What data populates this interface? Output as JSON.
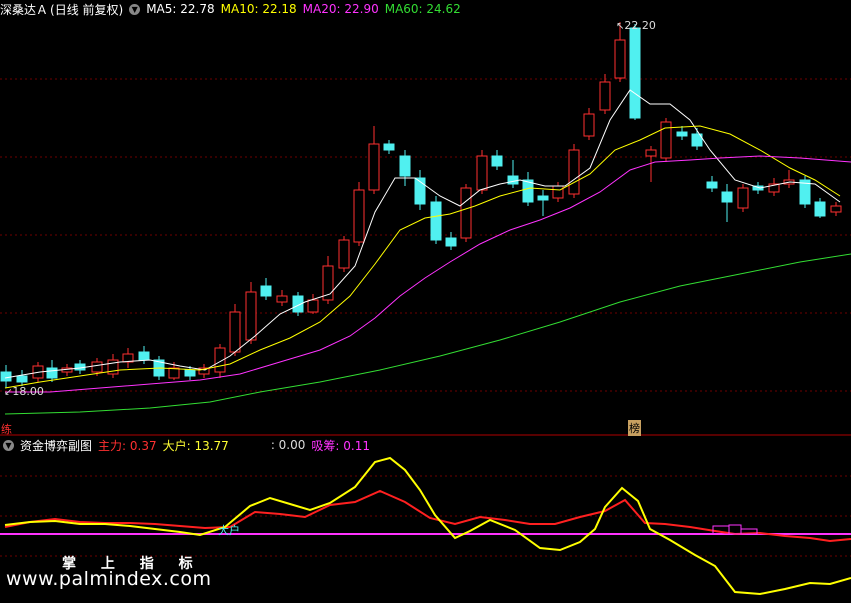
{
  "main_header": {
    "stock": "深桑达Ａ",
    "adjust": "(日线 前复权)",
    "ma": [
      {
        "label": "MA5: 22.78",
        "color": "#ffffff"
      },
      {
        "label": "MA10: 22.18",
        "color": "#ffff00"
      },
      {
        "label": "MA20: 22.90",
        "color": "#ff33ff"
      },
      {
        "label": "MA60: 24.62",
        "color": "#33dd33"
      }
    ]
  },
  "price_labels": {
    "high": "22.20",
    "low": "18.00"
  },
  "marks": {
    "left_badge": "练",
    "top_badge": "榜"
  },
  "sub_header": {
    "title": "资金博弈副图",
    "items": [
      {
        "label": "主力: 0.37",
        "color": "#ff3030"
      },
      {
        "label": "大户: 13.77",
        "color": "#ffff33"
      },
      {
        "label": ": 0.00",
        "color": "#dddddd"
      },
      {
        "label": "吸筹: 0.11",
        "color": "#ff33ff"
      }
    ]
  },
  "sub_marks": {
    "dahu_label": "大户"
  },
  "watermark": {
    "cn": "掌 上 指 标",
    "url": "www.palmindex.com"
  },
  "colors": {
    "up": "#ff3030",
    "down": "#50f0f0",
    "bg": "#000000",
    "grid": "#8b0000"
  }
}
